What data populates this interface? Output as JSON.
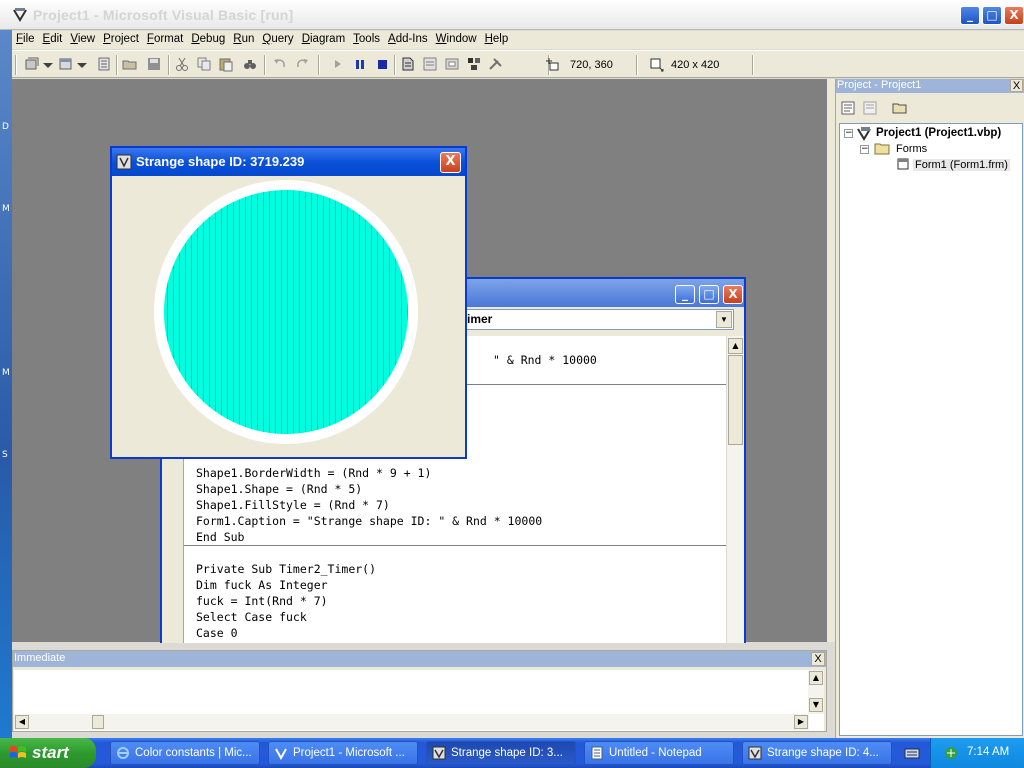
{
  "app": {
    "title": "Project1 - Microsoft Visual Basic [run]",
    "minimize": "_",
    "maximize": "□",
    "close": "X"
  },
  "menu": [
    "File",
    "Edit",
    "View",
    "Project",
    "Format",
    "Debug",
    "Run",
    "Query",
    "Diagram",
    "Tools",
    "Add-Ins",
    "Window",
    "Help"
  ],
  "toolbar": {
    "position_readout": "720, 360",
    "size_readout": "420 x 420"
  },
  "left_strip": [
    "D",
    "M",
    "M",
    "S"
  ],
  "project_explorer": {
    "title": "Project - Project1",
    "close": "X",
    "tree": {
      "project": "Project1 (Project1.vbp)",
      "folder": "Forms",
      "form": "Form1 (Form1.frm)"
    }
  },
  "code_window": {
    "procedure_combo": "imer",
    "lines_top": [
      "\" & Rnd * 10000"
    ],
    "lines": [
      "Shape1.BorderWidth = (Rnd * 9 + 1)",
      "Shape1.Shape = (Rnd * 5)",
      "Shape1.FillStyle = (Rnd * 7)",
      "Form1.Caption = \"Strange shape ID: \" & Rnd * 10000",
      "End Sub"
    ],
    "lines2": [
      "Private Sub Timer2_Timer()",
      "Dim fuck As Integer",
      "fuck = Int(Rnd * 7)",
      "Select Case fuck",
      "Case 0"
    ]
  },
  "form_window": {
    "title": "Strange shape ID: 3719.239",
    "close": "X",
    "shape": {
      "kind": "circle",
      "fill_color": "#00ffe0",
      "hatch_color": "#00d8d8",
      "border_color": "#ffffff",
      "fill_style": "vertical-lines"
    }
  },
  "immediate": {
    "title": "Immediate",
    "close": "X"
  },
  "taskbar": {
    "start": "start",
    "tasks": [
      {
        "label": "Color constants | Mic...",
        "icon": "ie-icon"
      },
      {
        "label": "Project1 - Microsoft ...",
        "icon": "vb-icon"
      },
      {
        "label": "Strange shape ID: 3...",
        "icon": "form-icon",
        "active": true
      },
      {
        "label": "Untitled - Notepad",
        "icon": "notepad-icon"
      },
      {
        "label": "Strange shape ID: 4...",
        "icon": "form-icon"
      }
    ],
    "clock": "7:14 AM"
  }
}
